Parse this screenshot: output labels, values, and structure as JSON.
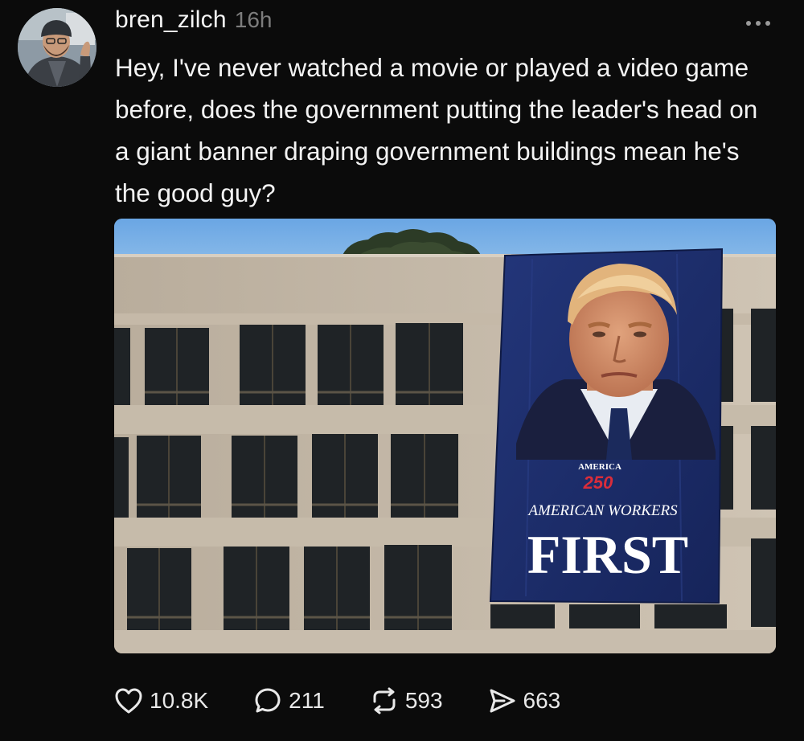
{
  "post": {
    "username": "bren_zilch",
    "timestamp": "16h",
    "text": "Hey, I've never watched a movie or played a video game before, does the government putting the leader's head on a giant banner draping government buildings mean he's the good guy?",
    "media": {
      "banner": {
        "line1": "AMERICA",
        "line2": "250",
        "line3": "AMERICAN WORKERS",
        "line4": "FIRST"
      }
    },
    "actions": {
      "likes": "10.8K",
      "replies": "211",
      "reposts": "593",
      "shares": "663"
    }
  },
  "icons": {
    "like": "heart-icon",
    "reply": "comment-icon",
    "repost": "repost-icon",
    "share": "send-icon",
    "more": "more-options-icon"
  },
  "colors": {
    "background": "#0b0b0b",
    "text": "#f3f3f3",
    "muted": "#7d7d7d",
    "banner_blue": "#1e2f6e"
  }
}
